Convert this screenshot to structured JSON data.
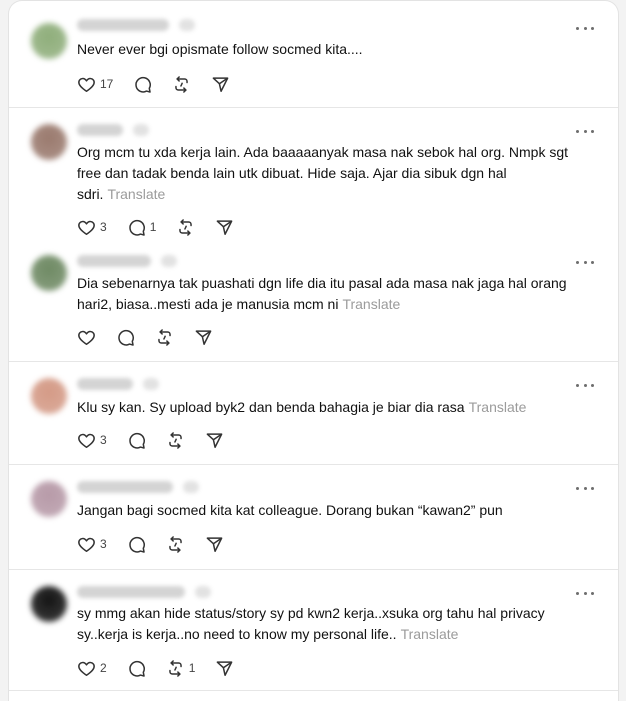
{
  "posts": [
    {
      "avatar_color": "#8fae7b",
      "text": "Never ever bgi opismate follow socmed kita....",
      "translate": "",
      "likes": "17",
      "replies": "",
      "reposts": ""
    },
    {
      "avatar_color": "#9a7a6e",
      "text": "Org mcm tu xda kerja lain. Ada baaaaanyak masa nak sebok hal org. Nmpk sgt free dan tadak benda lain utk dibuat. Hide saja. Ajar dia sibuk dgn hal sdri.",
      "translate": "Translate",
      "likes": "3",
      "replies": "1",
      "reposts": ""
    },
    {
      "avatar_color": "#6f8a64",
      "text": "Dia sebenarnya tak puashati dgn life dia itu pasal ada masa nak jaga hal orang hari2, biasa..mesti ada je manusia mcm ni",
      "translate": "Translate",
      "likes": "",
      "replies": "",
      "reposts": ""
    },
    {
      "avatar_color": "#d49a86",
      "text": "Klu sy kan. Sy upload byk2 dan benda bahagia je biar dia rasa",
      "translate": "Translate",
      "likes": "3",
      "replies": "",
      "reposts": ""
    },
    {
      "avatar_color": "#b79aa8",
      "text": "Jangan bagi socmed kita kat colleague. Dorang bukan “kawan2” pun",
      "translate": "",
      "likes": "3",
      "replies": "",
      "reposts": ""
    },
    {
      "avatar_color": "#141414",
      "text": "sy mmg akan hide status/story sy pd kwn2 kerja..xsuka org tahu hal privacy sy..kerja is kerja..no need to know my personal life..",
      "translate": "Translate",
      "likes": "2",
      "replies": "",
      "reposts": "1"
    }
  ]
}
